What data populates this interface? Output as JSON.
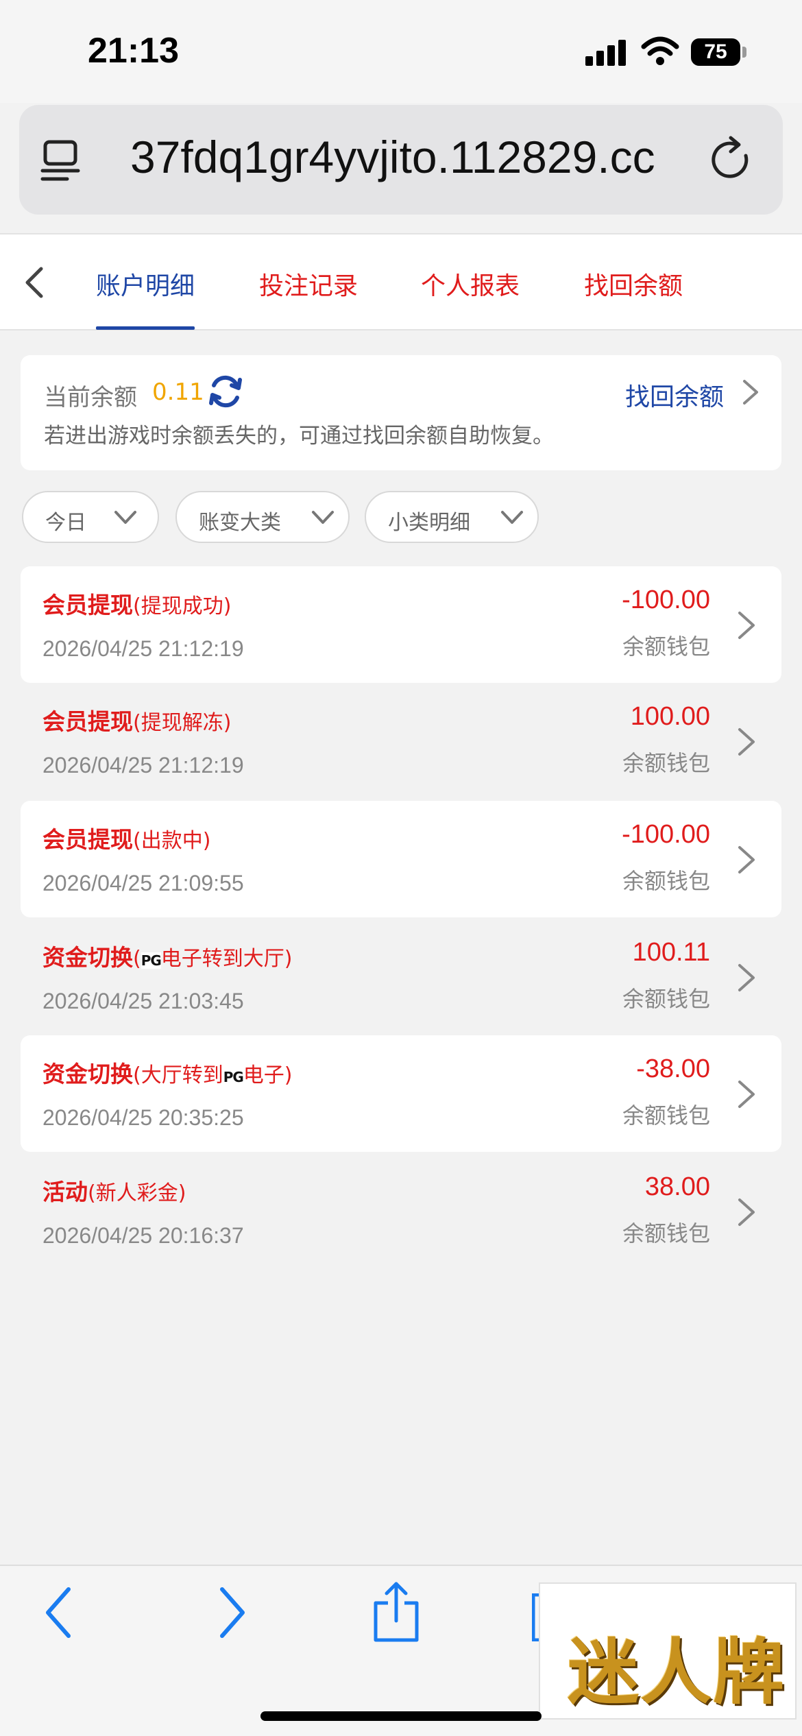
{
  "status": {
    "time": "21:13",
    "battery": "75"
  },
  "browser": {
    "url": "37fdq1gr4yvjito.112829.cc"
  },
  "nav": {
    "tabs": [
      {
        "label": "账户明细",
        "active": true
      },
      {
        "label": "投注记录"
      },
      {
        "label": "个人报表"
      },
      {
        "label": "找回余额"
      }
    ]
  },
  "balance": {
    "label": "当前余额",
    "value": "0.11",
    "recover_link": "找回余额",
    "note": "若进出游戏时余额丢失的，可通过找回余额自助恢复。"
  },
  "filters": [
    {
      "label": "今日"
    },
    {
      "label": "账变大类"
    },
    {
      "label": "小类明细"
    }
  ],
  "records": [
    {
      "type": "会员提现",
      "detail": "(提现成功)",
      "date": "2026/04/25 21:12:19",
      "amount": "-100.00",
      "wallet": "余额钱包"
    },
    {
      "type": "会员提现",
      "detail": "(提现解冻)",
      "date": "2026/04/25 21:12:19",
      "amount": "100.00",
      "wallet": "余额钱包"
    },
    {
      "type": "会员提现",
      "detail": "(出款中)",
      "date": "2026/04/25 21:09:55",
      "amount": "-100.00",
      "wallet": "余额钱包"
    },
    {
      "type": "资金切换",
      "detail_pre": "(",
      "detail_logo": "PG",
      "detail_post": "电子转到大厅)",
      "date": "2026/04/25 21:03:45",
      "amount": "100.11",
      "wallet": "余额钱包"
    },
    {
      "type": "资金切换",
      "detail_pre": "(大厅转到",
      "detail_logo": "PG",
      "detail_post": "电子)",
      "date": "2026/04/25 20:35:25",
      "amount": "-38.00",
      "wallet": "余额钱包"
    },
    {
      "type": "活动",
      "detail": "(新人彩金)",
      "date": "2026/04/25 20:16:37",
      "amount": "38.00",
      "wallet": "余额钱包"
    }
  ],
  "toolbar": {
    "icons": [
      "back-icon",
      "forward-icon",
      "share-icon",
      "bookmarks-icon"
    ]
  },
  "watermark": {
    "text": "迷人牌"
  },
  "colors": {
    "accent": "#1f47a6",
    "red": "#e01c1c",
    "gold": "#f0a500"
  }
}
